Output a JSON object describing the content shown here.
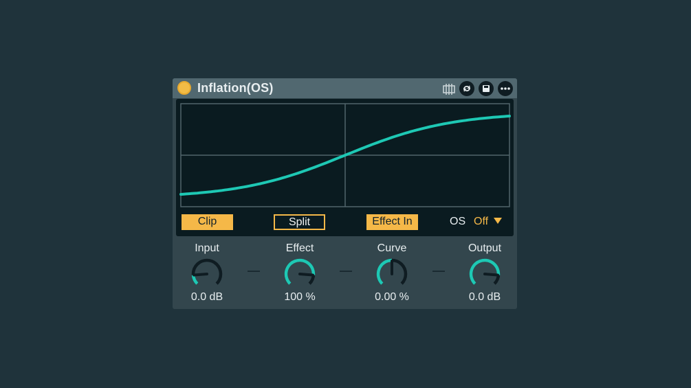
{
  "device": {
    "title": "Inflation(OS)",
    "power_on": true
  },
  "titlebar_icons": [
    "tune-icon",
    "swap-icon",
    "save-icon",
    "more-icon"
  ],
  "buttons": {
    "clip": "Clip",
    "split": "Split",
    "effect_in": "Effect In"
  },
  "os": {
    "label": "OS",
    "value": "Off"
  },
  "knobs": [
    {
      "label": "Input",
      "value": "0.0 dB",
      "level": 0.15
    },
    {
      "label": "Effect",
      "value": "100 %",
      "level": 0.85
    },
    {
      "label": "Curve",
      "value": "0.00 %",
      "level": 0.5
    },
    {
      "label": "Output",
      "value": "0.0 dB",
      "level": 0.85
    }
  ],
  "colors": {
    "accent": "#f5b848",
    "curve": "#1ec8b4",
    "knob_track": "#0f1c22",
    "background": "#1f333b"
  }
}
